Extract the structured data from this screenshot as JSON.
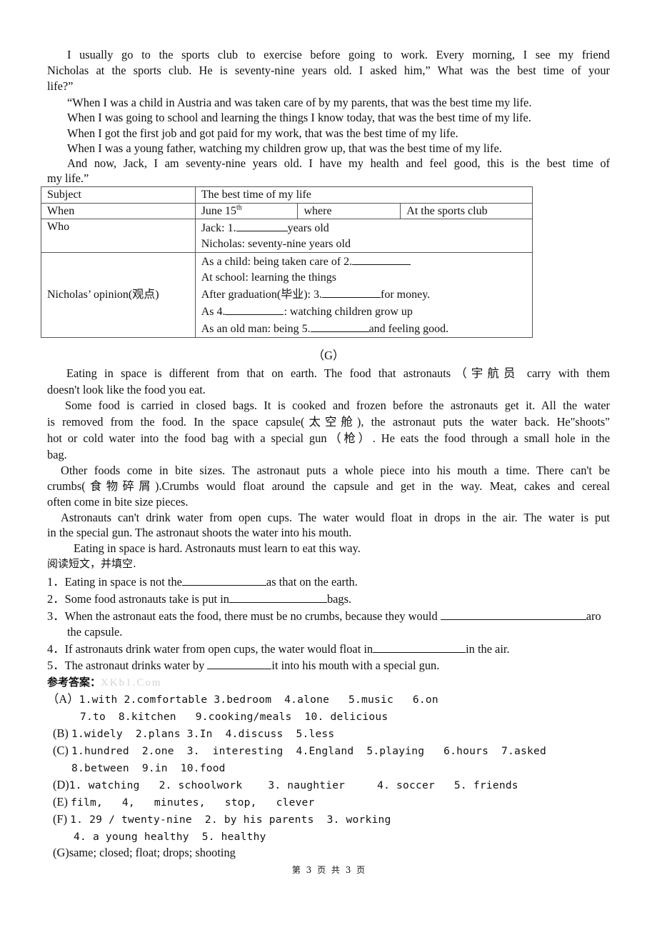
{
  "passage_f": {
    "paragraphs": [
      [
        "I usually go to the sports club to exercise before going to work. Every morning, I see my friend",
        "Nicholas at the sports club. He is seventy-nine years old. I asked him,” What was the best time of your",
        "life?”"
      ],
      [
        "“When I was a child in Austria and was taken care of by my parents, that was the best time my life."
      ],
      [
        "When I was going to school and learning the things I know today, that was the best time of my life."
      ],
      [
        "When I got the first job and got paid for my work, that was the best time of my life."
      ],
      [
        "When I was a young father, watching my children grow up, that was the best time of my life."
      ],
      [
        "And now, Jack, I am seventy-nine years old. I have my health and feel good, this is the best time of",
        "my life.”"
      ]
    ]
  },
  "table": {
    "subject_label": "Subject",
    "subject_value": "The best time of my life",
    "when_label": "When",
    "when_value": "June 15",
    "when_sup": "th",
    "where_label": "where",
    "where_value": "At the sports club",
    "who_label": "Who",
    "who_jack_pre": "Jack: 1.",
    "who_jack_post": "years old",
    "who_nicholas": "Nicholas: seventy-nine years old",
    "opinion_label": "Nicholas’ opinion(观点)",
    "opinion_lines": [
      {
        "pre": "As a child: being taken care of 2.",
        "post": ""
      },
      {
        "pre": "At school: learning the things",
        "post": null
      },
      {
        "pre": "After graduation(毕业): 3.",
        "post": "for money."
      },
      {
        "pre": "As 4.",
        "post": ": watching children grow up"
      },
      {
        "pre": "As an old man: being 5.",
        "post": "and feeling good."
      }
    ]
  },
  "passage_g": {
    "heading": "（G）",
    "paragraphs": [
      [
        "Eating in space is different from that on earth. The food that astronauts（宇航员 carry with them",
        "doesn't look like the food you eat."
      ],
      [
        "Some food is carried in closed bags. It is cooked and frozen before the astronauts get it. All the water",
        "is removed from the food. In the space capsule(太空舱), the    astronaut puts the water back. He\"shoots\"",
        "hot or cold water into the food bag with a special gun（枪）. He eats the food through a small hole in the",
        "bag."
      ],
      [
        "Other foods come in bite sizes. The astronaut puts a whole piece into his mouth a time. There can't be",
        "crumbs(食物碎屑).Crumbs would float around the capsule and get in the way. Meat, cakes and cereal",
        "often come in bite size pieces."
      ],
      [
        "Astronauts can't drink water from open cups. The water would float in drops in the air. The water is put",
        "in the special gun. The astronaut shoots the water into his mouth."
      ],
      [
        "Eating in space is hard. Astronauts must learn to eat this way."
      ]
    ],
    "instruction": "阅读短文，并填空.",
    "questions": [
      {
        "num": "1．",
        "pre": "Eating in space is not the",
        "post": "as that on the earth."
      },
      {
        "num": "2．",
        "pre": "Some food astronauts take is put in",
        "post": "bags."
      },
      {
        "num": "3．",
        "pre": "When the astronaut eats the food, there must be no crumbs, because they would ",
        "post": "aro",
        "cont": "the capsule."
      },
      {
        "num": "4．",
        "pre": "If astronauts drink water from open cups, the water would float in",
        "post": "in the air."
      },
      {
        "num": "5．",
        "pre": "The astronaut drinks water by ",
        "post": "it into his mouth with a special gun."
      }
    ]
  },
  "answers": {
    "title": "参考答案：",
    "watermark": "XKb1.Com",
    "lines": [
      {
        "label": "（A）",
        "text": "1.with 2.comfortable 3.bedroom  4.alone   5.music   6.on"
      },
      {
        "label": "",
        "text": "7.to  8.kitchen   9.cooking/meals  10. delicious"
      },
      {
        "label": "(B)",
        "text": "1.widely  2.plans 3.In  4.discuss  5.less"
      },
      {
        "label": "(C)",
        "text": "1.hundred  2.one  3.  interesting  4.England  5.playing   6.hours  7.asked"
      },
      {
        "label": "",
        "text": "8.between  9.in  10.food"
      },
      {
        "label": "(D)",
        "text": "1. watching   2. schoolwork    3. naughtier     4. soccer   5. friends"
      },
      {
        "label": "(E)",
        "text": "film,   4,   minutes,   stop,   clever"
      },
      {
        "label": "(F)",
        "text": "1. 29 / twenty-nine  2. by his parents  3. working"
      },
      {
        "label": "",
        "text": "4. a young healthy  5. healthy"
      },
      {
        "label": "(G)",
        "text": "same; closed; float; drops; shooting"
      }
    ]
  },
  "footer": {
    "page_text": "第 3 页 共 3 页"
  }
}
